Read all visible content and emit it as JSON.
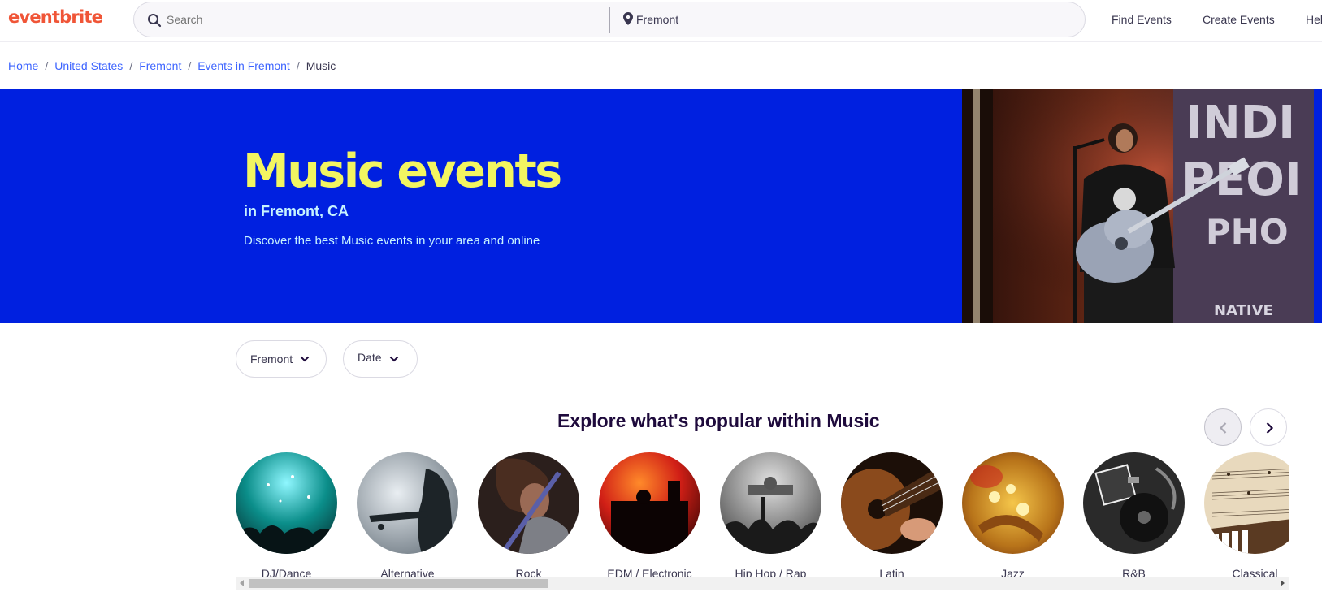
{
  "brand": {
    "logo_text": "eventbrite",
    "color": "#f05537"
  },
  "header": {
    "search_placeholder": "Search",
    "location_value": "Fremont",
    "nav": [
      "Find Events",
      "Create Events",
      "Hel"
    ]
  },
  "breadcrumb": {
    "items": [
      "Home",
      "United States",
      "Fremont",
      "Events in Fremont"
    ],
    "current": "Music"
  },
  "hero": {
    "title": "Music events",
    "subtitle": "in Fremont, CA",
    "description": "Discover the best Music events in your area and online",
    "background": "#0020e0",
    "title_color": "#f2f561"
  },
  "filters": {
    "location": "Fremont",
    "date": "Date"
  },
  "explore": {
    "title": "Explore what's popular within Music",
    "categories": [
      {
        "label": "DJ/Dance"
      },
      {
        "label": "Alternative"
      },
      {
        "label": "Rock"
      },
      {
        "label": "EDM / Electronic"
      },
      {
        "label": "Hip Hop / Rap"
      },
      {
        "label": "Latin"
      },
      {
        "label": "Jazz"
      },
      {
        "label": "R&B"
      },
      {
        "label": "Classical"
      }
    ]
  },
  "icons": {
    "search": "search-icon",
    "location": "location-pin-icon",
    "chevron": "chevron-down-icon",
    "prev": "chevron-left-icon",
    "next": "chevron-right-icon"
  }
}
